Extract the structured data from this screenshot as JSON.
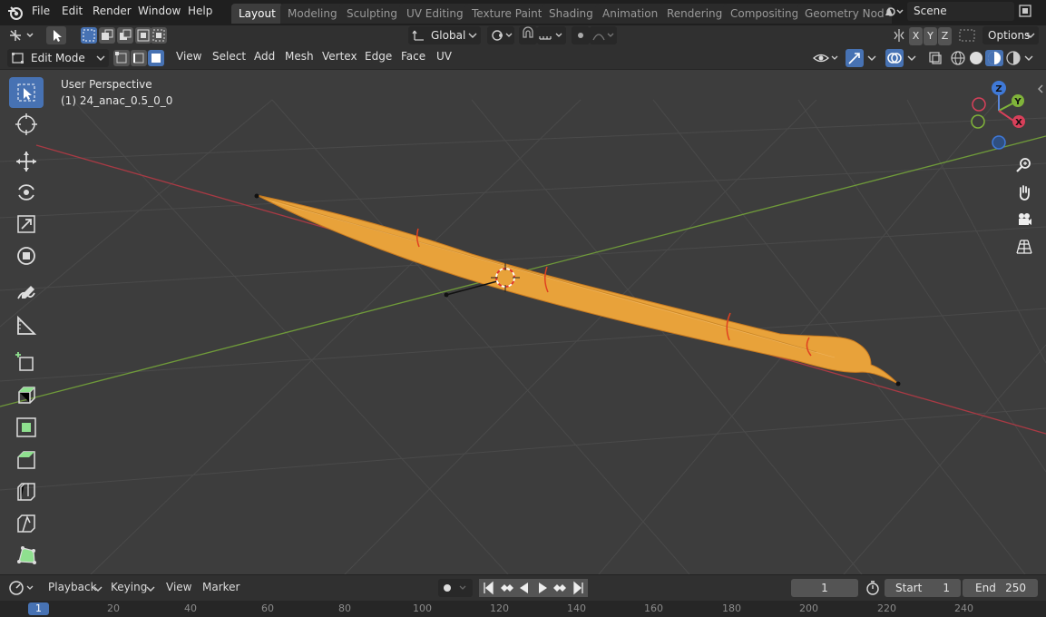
{
  "menus": [
    "File",
    "Edit",
    "Render",
    "Window",
    "Help"
  ],
  "workspaces": [
    "Layout",
    "Modeling",
    "Sculpting",
    "UV Editing",
    "Texture Paint",
    "Shading",
    "Animation",
    "Rendering",
    "Compositing",
    "Geometry Nod"
  ],
  "active_workspace": "Layout",
  "scene_name": "Scene",
  "header1": {
    "orientation": "Global",
    "axes": [
      "X",
      "Y",
      "Z"
    ],
    "options_label": "Options"
  },
  "header2": {
    "mode": "Edit Mode",
    "menus": [
      "View",
      "Select",
      "Add",
      "Mesh",
      "Vertex",
      "Edge",
      "Face",
      "UV"
    ]
  },
  "viewport": {
    "perspective_label": "User Perspective",
    "object_label": "(1) 24_anac_0.5_0_0",
    "gizmo_axes": [
      "X",
      "Y",
      "Z"
    ]
  },
  "toolbar_tools": [
    "select-box",
    "cursor",
    "move",
    "rotate",
    "scale",
    "transform",
    "annotate",
    "measure",
    "add-cube",
    "extrude",
    "inset",
    "bevel",
    "loop-cut",
    "knife",
    "poly-build"
  ],
  "timeline": {
    "menus": [
      "Playback",
      "Keying",
      "View",
      "Marker"
    ],
    "current_frame": "1",
    "start_label": "Start",
    "start_value": "1",
    "end_label": "End",
    "end_value": "250",
    "ruler_current": "1",
    "ticks": [
      "20",
      "40",
      "60",
      "80",
      "100",
      "120",
      "140",
      "160",
      "180",
      "200",
      "220",
      "240"
    ]
  },
  "colors": {
    "accent": "#4772b3",
    "mesh": "#e8a23a",
    "x_axis": "#c0404a",
    "y_axis": "#6f9a3a"
  }
}
